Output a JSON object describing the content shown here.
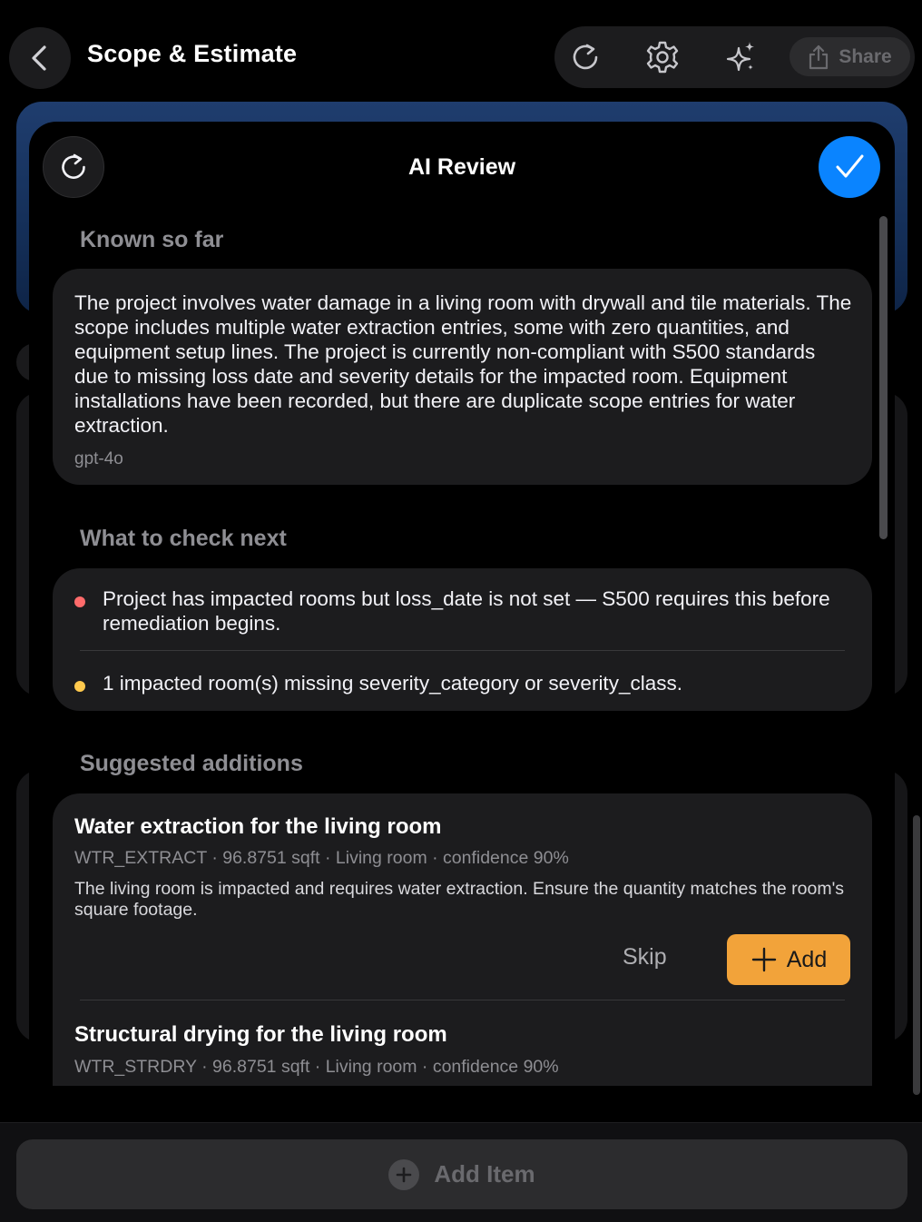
{
  "header": {
    "title": "Scope & Estimate",
    "share_label": "Share"
  },
  "sheet": {
    "title": "AI Review",
    "known": {
      "heading": "Known so far",
      "summary": "The project involves water damage in a living room with drywall and tile materials. The scope includes multiple water extraction entries, some with zero quantities, and equipment setup lines. The project is currently non-compliant with S500 standards due to missing loss date and severity details for the impacted room. Equipment installations have been recorded, but there are duplicate scope entries for water extraction.",
      "model": "gpt-4o"
    },
    "checks": {
      "heading": "What to check next",
      "items": [
        {
          "text": "Project has impacted rooms but loss_date is not set — S500 requires this before remediation begins.",
          "color": "#ff6b6b"
        },
        {
          "text": "1 impacted room(s) missing severity_category or severity_class.",
          "color": "#ffc94d"
        }
      ]
    },
    "suggestions": {
      "heading": "Suggested additions",
      "items": [
        {
          "title": "Water extraction for the living room",
          "meta": "WTR_EXTRACT · 96.8751 sqft · Living room · confidence 90%",
          "description": "The living room is impacted and requires water extraction. Ensure the quantity matches the room's square footage.",
          "skip_label": "Skip",
          "add_label": "Add"
        },
        {
          "title": "Structural drying for the living room",
          "meta": "WTR_STRDRY · 96.8751 sqft · Living room · confidence 90%"
        }
      ]
    }
  },
  "footer": {
    "add_item_label": "Add Item"
  },
  "colors": {
    "accent_blue": "#0a84ff",
    "add_orange": "#f2a33a",
    "card_bg": "#1c1c1e"
  }
}
